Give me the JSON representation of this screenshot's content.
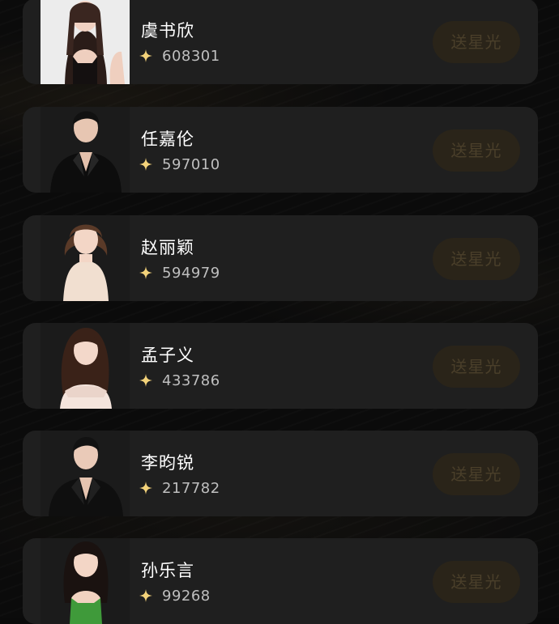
{
  "ranking": {
    "items": [
      {
        "name": "虞书欣",
        "score": "608301",
        "button": "送星光",
        "avatar": "female-portrait"
      },
      {
        "name": "任嘉伦",
        "score": "597010",
        "button": "送星光",
        "avatar": "male-portrait"
      },
      {
        "name": "赵丽颖",
        "score": "594979",
        "button": "送星光",
        "avatar": "female-portrait"
      },
      {
        "name": "孟子义",
        "score": "433786",
        "button": "送星光",
        "avatar": "female-portrait"
      },
      {
        "name": "李昀锐",
        "score": "217782",
        "button": "送星光",
        "avatar": "male-portrait"
      },
      {
        "name": "孙乐言",
        "score": "99268",
        "button": "送星光",
        "avatar": "female-portrait"
      }
    ]
  },
  "icons": {
    "score_icon": "sparkle-star-icon"
  },
  "colors": {
    "page_background": "#0b0b0b",
    "card_background": "#1f1f1f",
    "name_text": "#ffffff",
    "score_text": "#bfbfbf",
    "button_background": "#2a2419",
    "button_text": "#4a3f2a",
    "star_gold": "#f3d27a"
  }
}
